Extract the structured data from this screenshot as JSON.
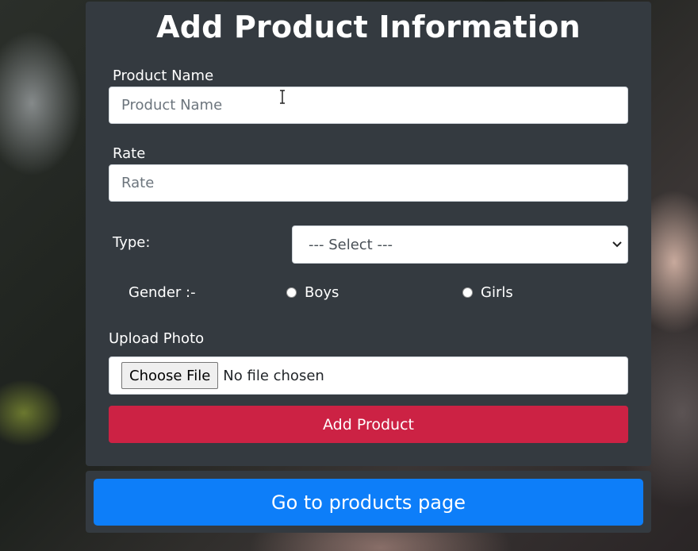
{
  "form": {
    "title": "Add Product Information",
    "product_name": {
      "label": "Product Name",
      "placeholder": "Product Name",
      "value": ""
    },
    "rate": {
      "label": "Rate",
      "placeholder": "Rate",
      "value": ""
    },
    "type": {
      "label": "Type:",
      "selected": "--- Select ---",
      "icon": "chevron-down-icon"
    },
    "gender": {
      "label": "Gender :-",
      "options": [
        "Boys",
        "Girls"
      ],
      "selected": null
    },
    "upload": {
      "label": "Upload Photo",
      "button": "Choose File",
      "status": "No file chosen"
    },
    "submit_label": "Add Product"
  },
  "navigation": {
    "go_label": "Go to products page"
  },
  "colors": {
    "card": "#343a40",
    "submit": "#cc2244",
    "primary": "#0d7ef9"
  }
}
